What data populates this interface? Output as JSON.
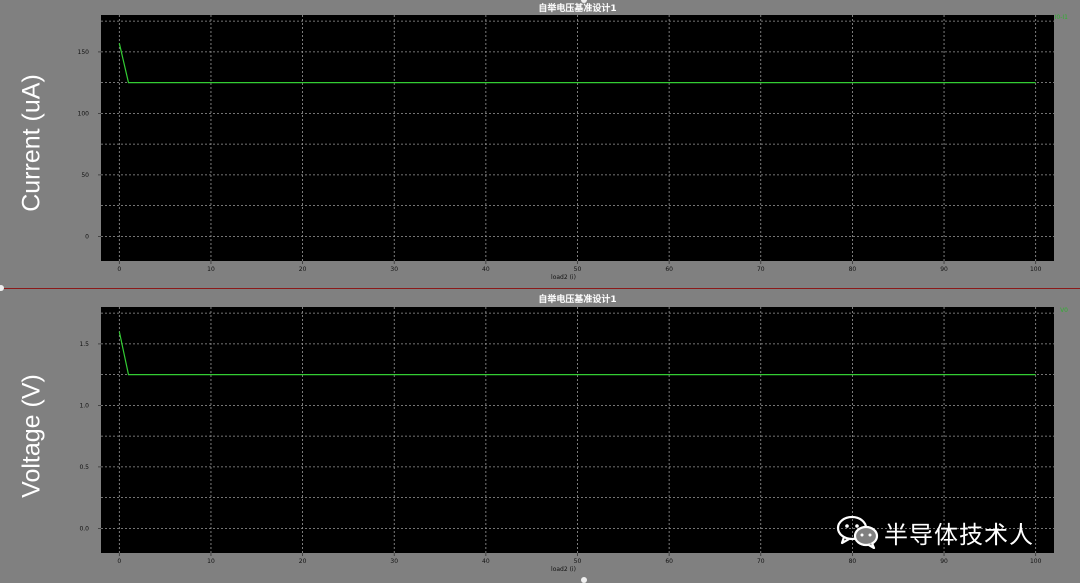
{
  "panels": [
    {
      "title": "自举电压基准设计1",
      "ylabel": "Current (uA)",
      "xlabel": "load2 (i)",
      "legend": "I0-I1",
      "chart_data": {
        "type": "line",
        "title": "自举电压基准设计1",
        "xlabel": "load2 (i)",
        "ylabel": "Current (uA)",
        "xlim": [
          -2,
          102
        ],
        "ylim": [
          -20,
          180
        ],
        "xticks": [
          0,
          10,
          20,
          30,
          40,
          50,
          60,
          70,
          80,
          90,
          100
        ],
        "yticks": [
          0,
          50,
          100,
          150
        ],
        "ytick_labels": [
          "0",
          "50",
          "100",
          "150"
        ],
        "grid": true,
        "series": [
          {
            "name": "I0-I1",
            "color": "#33cc33",
            "x": [
              0,
              1,
              100
            ],
            "y": [
              157,
              125,
              125
            ]
          }
        ]
      }
    },
    {
      "title": "自举电压基准设计1",
      "ylabel": "Voltage (V)",
      "xlabel": "load2 (i)",
      "legend": "V0",
      "chart_data": {
        "type": "line",
        "title": "自举电压基准设计1",
        "xlabel": "load2 (i)",
        "ylabel": "Voltage (V)",
        "xlim": [
          -2,
          102
        ],
        "ylim": [
          -0.2,
          1.8
        ],
        "xticks": [
          0,
          10,
          20,
          30,
          40,
          50,
          60,
          70,
          80,
          90,
          100
        ],
        "yticks": [
          0,
          0.5,
          1.0,
          1.5
        ],
        "ytick_labels": [
          "0.0",
          "0.5",
          "1.0",
          "1.5"
        ],
        "grid": true,
        "series": [
          {
            "name": "V0",
            "color": "#33cc33",
            "x": [
              0,
              1,
              100
            ],
            "y": [
              1.6,
              1.25,
              1.25
            ]
          }
        ]
      }
    }
  ],
  "watermark": {
    "text": "半导体技术人",
    "icon": "wechat-icon"
  }
}
